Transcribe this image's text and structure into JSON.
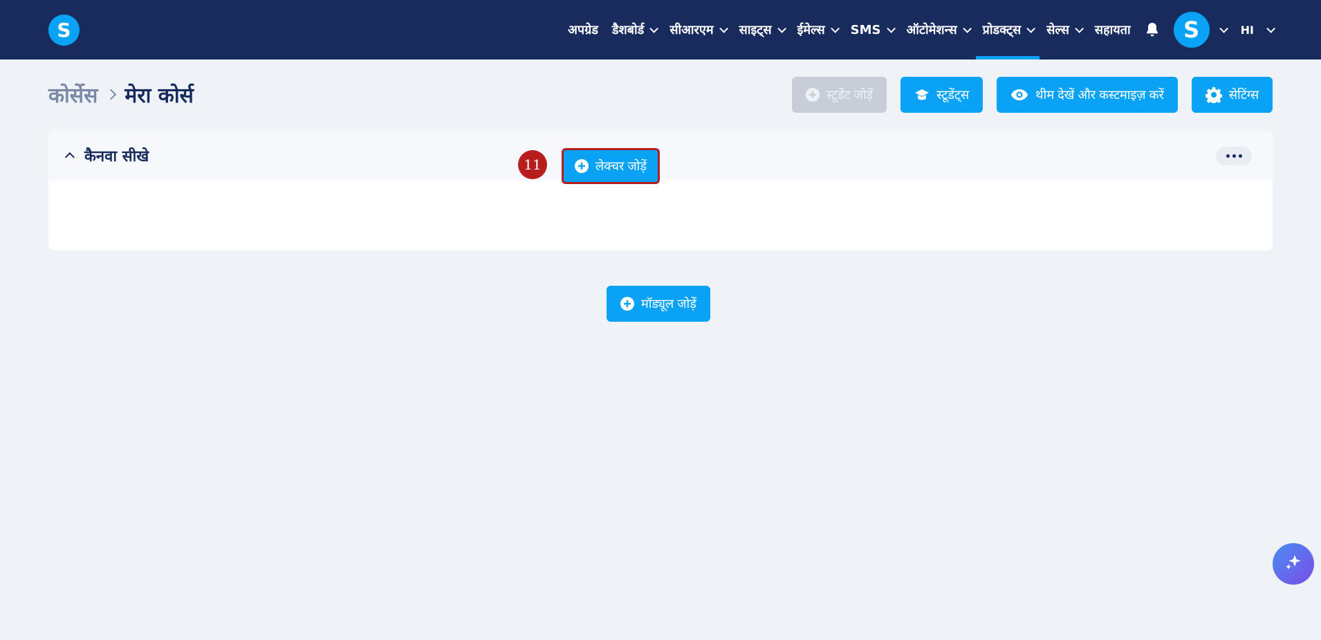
{
  "brand": {
    "logo_letter": "S"
  },
  "nav": {
    "items": [
      {
        "label": "अपग्रेड",
        "has_dropdown": false
      },
      {
        "label": "डैशबोर्ड",
        "has_dropdown": true
      },
      {
        "label": "सीआरएम",
        "has_dropdown": true
      },
      {
        "label": "साइट्स",
        "has_dropdown": true
      },
      {
        "label": "ईमेल्स",
        "has_dropdown": true
      },
      {
        "label": "SMS",
        "has_dropdown": true
      },
      {
        "label": "ऑटोमेशन्स",
        "has_dropdown": true
      },
      {
        "label": "प्रोडक्ट्स",
        "has_dropdown": true,
        "active": true
      },
      {
        "label": "सेल्स",
        "has_dropdown": true
      },
      {
        "label": "सहायता",
        "has_dropdown": false
      }
    ],
    "avatar_letter": "S",
    "language": "HI"
  },
  "breadcrumb": {
    "root": "कोर्सेस",
    "current": "मेरा कोर्स"
  },
  "actions": {
    "add_student": "स्टूडेंट जोड़ें",
    "students": "स्टूडेंट्स",
    "view_theme": "थीम देखें और कस्टमाइज़ करें",
    "settings": "सेटिंग्स"
  },
  "module": {
    "title": "कैनवा सीखे",
    "add_lecture": "लेक्चर जोड़ें"
  },
  "step_marker": "11",
  "add_module": "मॉड्यूल जोड़ें",
  "colors": {
    "primary": "#0aa2f5",
    "nav_bg": "#172b5d",
    "highlight": "#b81d1d"
  }
}
